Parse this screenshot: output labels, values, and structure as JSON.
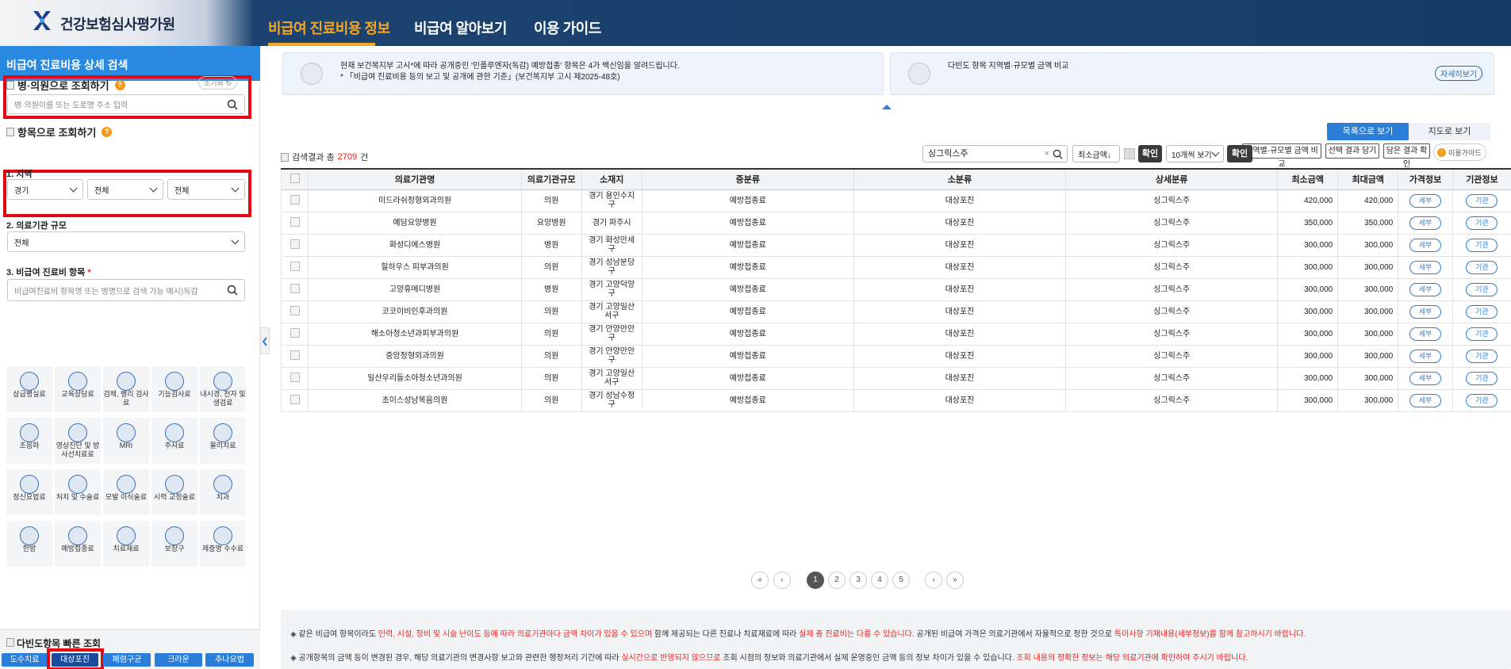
{
  "header": {
    "logo_text": "건강보험심사평가원",
    "nav": [
      "비급여 진료비용 정보",
      "비급여 알아보기",
      "이용 가이드"
    ]
  },
  "sidebar": {
    "title": "비급여 진료비용 상세 검색",
    "hospital_search": {
      "title": "병·의원으로 조회하기",
      "reset_label": "초기화",
      "placeholder": "병·의원이름 또는 도로명 주소 입력"
    },
    "item_search_title": "항목으로 조회하기",
    "region": {
      "label": "1. 지역",
      "values": [
        "경기",
        "전체",
        "전체"
      ]
    },
    "scale": {
      "label": "2. 의료기관 규모",
      "value": "전체"
    },
    "item": {
      "label": "3. 비급여 진료비 항목",
      "required_mark": "*",
      "placeholder": "비급여진료비 항목명 또는 병명으로 검색 가능 예시)독감"
    },
    "categories": [
      "상급병실료",
      "교육상담료",
      "검체, 병리 검사료",
      "기능검사료",
      "내시경, 천자 및 생검료",
      "초음파",
      "영상진단 및 방사선치료료",
      "MRI",
      "주사료",
      "물리치료",
      "정신요법료",
      "처치 및 수술료",
      "모발 이식술료",
      "시력 교정술료",
      "치과",
      "한방",
      "예방접종료",
      "치료재료",
      "보장구",
      "제증명 수수료"
    ],
    "quick": {
      "title": "다빈도항목 빠른 조회",
      "items": [
        "도수치료",
        "대상포진",
        "폐렴구균",
        "크라운",
        "추나요법"
      ],
      "active": "대상포진"
    }
  },
  "notices": {
    "left_line1": "현재 보건복지부 고시*에 따라 공개중인 '인플루엔자(독감) 예방접종' 항목은 4가 백신임을 알려드립니다.",
    "left_line2": "* 「비급여 진료비용 등의 보고 및 공개에 관한 기준」(보건복지부 고시 제2025-48호)",
    "right_text": "다빈도 항목 지역별·규모별 금액 비교",
    "more_label": "자세히보기"
  },
  "view_tabs": {
    "list": "목록으로 보기",
    "map": "지도로 보기"
  },
  "tools": [
    "지역별·규모별 금액 비교",
    "선택 결과 담기",
    "담은 결과 확인"
  ],
  "guide_label": "이용가이드",
  "result": {
    "prefix": "검색결과 총 ",
    "count": "2709",
    "suffix": "건"
  },
  "search": {
    "value": "싱그릭스주",
    "sort": "최소금액↓",
    "confirm": "확인",
    "page_size": "10개씩 보기"
  },
  "table": {
    "headers": [
      "",
      "의료기관명",
      "의료기관규모",
      "소재지",
      "중분류",
      "소분류",
      "상세분류",
      "최소금액",
      "최대금액",
      "가격정보",
      "기관정보"
    ],
    "rows": [
      [
        "미드라쉬정형외과의원",
        "의원",
        "경기 용인수지구",
        "예방접종료",
        "대상포진",
        "싱그릭스주",
        "420,000",
        "420,000"
      ],
      [
        "예담요양병원",
        "요양병원",
        "경기 파주시",
        "예방접종료",
        "대상포진",
        "싱그릭스주",
        "350,000",
        "350,000"
      ],
      [
        "화성디에스병원",
        "병원",
        "경기 화성만세구",
        "예방접종료",
        "대상포진",
        "싱그릭스주",
        "300,000",
        "300,000"
      ],
      [
        "힐하우스 피부과의원",
        "의원",
        "경기 성남분당구",
        "예방접종료",
        "대상포진",
        "싱그릭스주",
        "300,000",
        "300,000"
      ],
      [
        "고양휴메디병원",
        "병원",
        "경기 고양덕양구",
        "예방접종료",
        "대상포진",
        "싱그릭스주",
        "300,000",
        "300,000"
      ],
      [
        "코코이비인후과의원",
        "의원",
        "경기 고양일산서구",
        "예방접종료",
        "대상포진",
        "싱그릭스주",
        "300,000",
        "300,000"
      ],
      [
        "해소아청소년과피부과의원",
        "의원",
        "경기 안양만안구",
        "예방접종료",
        "대상포진",
        "싱그릭스주",
        "300,000",
        "300,000"
      ],
      [
        "중앙정형외과의원",
        "의원",
        "경기 안양만안구",
        "예방접종료",
        "대상포진",
        "싱그릭스주",
        "300,000",
        "300,000"
      ],
      [
        "일산우리들소아청소년과의원",
        "의원",
        "경기 고양일산서구",
        "예방접종료",
        "대상포진",
        "싱그릭스주",
        "300,000",
        "300,000"
      ],
      [
        "초이스성남복음의원",
        "의원",
        "경기 성남수정구",
        "예방접종료",
        "대상포진",
        "싱그릭스주",
        "300,000",
        "300,000"
      ]
    ],
    "btn_detail": "세부",
    "btn_org": "기관"
  },
  "pagination": {
    "first": "«",
    "prev": "‹",
    "pages": [
      "1",
      "2",
      "3",
      "4",
      "5"
    ],
    "current": "1",
    "next": "›",
    "last": "»"
  },
  "bottom": {
    "l1_a": "◈ 같은 비급여 항목이라도 ",
    "l1_b": "인력, 시설, 장비 및 시술 난이도 등에 따라 의료기관마다 금액 차이가 있을 수 있으며",
    "l1_c": " 함께 제공되는 다른 진료나 치료재료에 따라 ",
    "l1_d": "실제 총 진료비는 다를 수 있습니다.",
    "l1_e": " 공개된 비급여 가격은 의료기관에서 자율적으로 정한 것으로 ",
    "l1_f": "특이사항 기재내용(세부정보)를 함께 참고하시기 바랍니다.",
    "l2_a": "◈ 공개항목의 금액 등이 변경된 경우, 해당 의료기관의 변경사항 보고와 관련한 행정처리 기간에 따라 ",
    "l2_b": "실시간으로 반영되지 않으므로",
    "l2_c": " 조회 시점의 정보와 의료기관에서 실제 운영중인 금액 등의 정보 차이가 있을 수 있습니다. ",
    "l2_d": "조회 내용의 정확한 정보는 해당 의료기관에 확인하여 주시기 바랍니다."
  }
}
